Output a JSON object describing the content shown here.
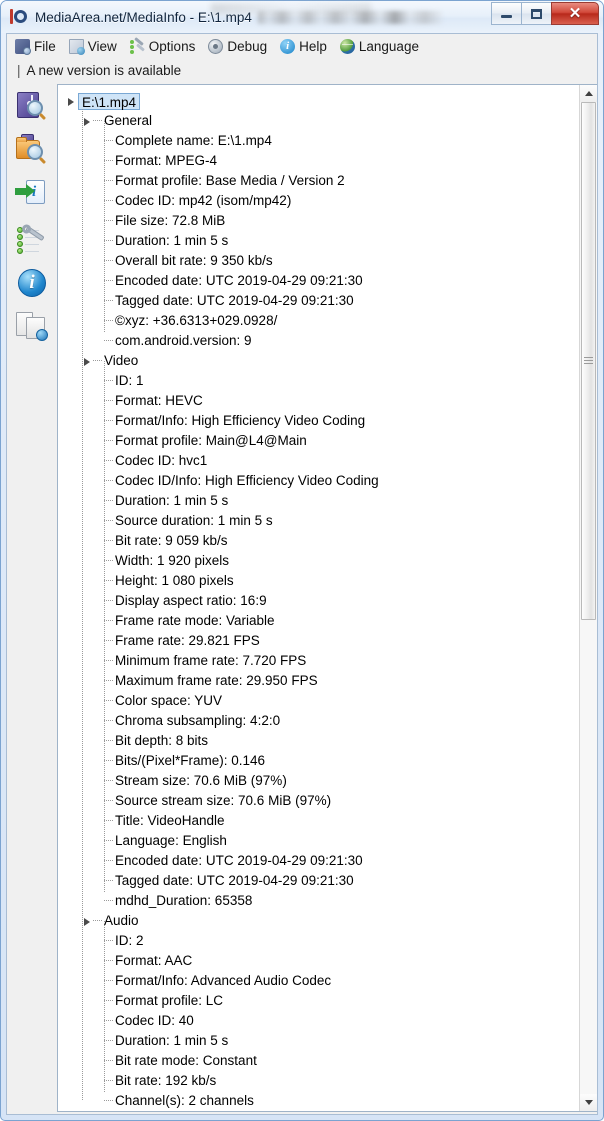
{
  "window": {
    "title": "MediaArea.net/MediaInfo - E:\\1.mp4",
    "app_icon": "media-info-icon",
    "controls": {
      "minimize": "–",
      "maximize": "□",
      "close": "✕"
    }
  },
  "menubar": {
    "items": [
      {
        "label": "File",
        "icon": "file-icon"
      },
      {
        "label": "View",
        "icon": "view-icon"
      },
      {
        "label": "Options",
        "icon": "options-icon"
      },
      {
        "label": "Debug",
        "icon": "debug-icon"
      },
      {
        "label": "Help",
        "icon": "help-icon"
      },
      {
        "label": "Language",
        "icon": "language-icon"
      }
    ]
  },
  "notification": {
    "prefix": "|",
    "text": "A new version is available"
  },
  "sidebar": {
    "items": [
      {
        "name": "open-file-button",
        "icon": "open-media-file-icon"
      },
      {
        "name": "open-folder-button",
        "icon": "open-folder-icon"
      },
      {
        "name": "export-button",
        "icon": "export-info-icon"
      },
      {
        "name": "preferences-button",
        "icon": "wrench-settings-icon"
      },
      {
        "name": "about-button",
        "icon": "info-circle-icon"
      },
      {
        "name": "report-button",
        "icon": "report-sheet-icon"
      }
    ]
  },
  "tree": {
    "root": {
      "label": "E:\\1.mp4",
      "selected": true,
      "expanded": true
    },
    "sections": [
      {
        "label": "General",
        "expanded": true,
        "rows": [
          "Complete name: E:\\1.mp4",
          "Format: MPEG-4",
          "Format profile: Base Media / Version 2",
          "Codec ID: mp42 (isom/mp42)",
          "File size: 72.8 MiB",
          "Duration: 1 min 5 s",
          "Overall bit rate: 9 350 kb/s",
          "Encoded date: UTC 2019-04-29 09:21:30",
          "Tagged date: UTC 2019-04-29 09:21:30",
          "©xyz: +36.6313+029.0928/",
          "com.android.version: 9"
        ]
      },
      {
        "label": "Video",
        "expanded": true,
        "rows": [
          "ID: 1",
          "Format: HEVC",
          "Format/Info: High Efficiency Video Coding",
          "Format profile: Main@L4@Main",
          "Codec ID: hvc1",
          "Codec ID/Info: High Efficiency Video Coding",
          "Duration: 1 min 5 s",
          "Source duration: 1 min 5 s",
          "Bit rate: 9 059 kb/s",
          "Width: 1 920 pixels",
          "Height: 1 080 pixels",
          "Display aspect ratio: 16:9",
          "Frame rate mode: Variable",
          "Frame rate: 29.821 FPS",
          "Minimum frame rate: 7.720 FPS",
          "Maximum frame rate: 29.950 FPS",
          "Color space: YUV",
          "Chroma subsampling: 4:2:0",
          "Bit depth: 8 bits",
          "Bits/(Pixel*Frame): 0.146",
          "Stream size: 70.6 MiB (97%)",
          "Source stream size: 70.6 MiB (97%)",
          "Title: VideoHandle",
          "Language: English",
          "Encoded date: UTC 2019-04-29 09:21:30",
          "Tagged date: UTC 2019-04-29 09:21:30",
          "mdhd_Duration: 65358"
        ]
      },
      {
        "label": "Audio",
        "expanded": true,
        "rows": [
          "ID: 2",
          "Format: AAC",
          "Format/Info: Advanced Audio Codec",
          "Format profile: LC",
          "Codec ID: 40",
          "Duration: 1 min 5 s",
          "Bit rate mode: Constant",
          "Bit rate: 192 kb/s",
          "Channel(s): 2 channels"
        ]
      }
    ]
  },
  "scrollbar": {
    "up_arrow": "▲",
    "down_arrow": "▼",
    "thumb_top_pct": 0,
    "thumb_height_pct": 52
  },
  "colors": {
    "selection": "#cfe4f7",
    "selection_border": "#7aa8d4",
    "close_button": "#c0392b",
    "window_border": "#7ba3d0"
  }
}
